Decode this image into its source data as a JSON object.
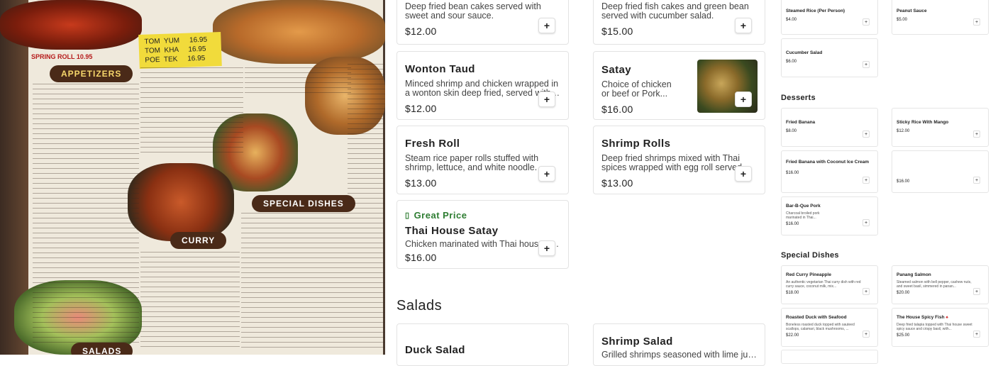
{
  "menu_photo": {
    "appetizers_header": "APPETIZERS",
    "special_header": "SPECIAL DISHES",
    "curry_header": "CURRY",
    "salads_header": "SALADS",
    "spring_note": "SPRING  ROLL  10.95",
    "sticky_note": [
      "TOM  YUM     16.95",
      "TOM  KHA     16.95",
      "POE  TEK     16.95"
    ]
  },
  "cards": {
    "c1": {
      "desc": "Deep fried bean cakes served with sweet and sour sauce.",
      "price": "$12.00"
    },
    "c2": {
      "desc": "Deep fried fish cakes and green bean served with cucumber salad.",
      "price": "$15.00"
    },
    "wonton": {
      "name": "Wonton Taud",
      "desc": "Minced shrimp and chicken wrapped in a wonton skin deep fried, served with sweet ...",
      "price": "$12.00"
    },
    "satay": {
      "name": "Satay",
      "desc": "Choice of chicken or beef or Pork...",
      "price": "$16.00"
    },
    "fresh_roll": {
      "name": "Fresh Roll",
      "desc": "Steam rice paper rolls stuffed with shrimp, lettuce, and white noodle.",
      "price": "$13.00"
    },
    "shrimp_rolls": {
      "name": "Shrimp Rolls",
      "desc": "Deep fried shrimps mixed with Thai spices wrapped with egg roll served with sweet...",
      "price": "$13.00"
    },
    "house_satay": {
      "badge": "Great Price",
      "name": "Thai House Satay",
      "desc": "Chicken marinated with Thai house special spices...",
      "price": "$16.00"
    }
  },
  "salads": {
    "title": "Salads",
    "duck": {
      "name": "Duck Salad"
    },
    "shrimp": {
      "name": "Shrimp Salad",
      "desc": "Grilled shrimps seasoned with lime juices"
    }
  },
  "right": {
    "sides": [
      {
        "name": "Steamed Rice (Per Person)",
        "price": "$4.00"
      },
      {
        "name": "Peanut Sauce",
        "price": "$5.00"
      },
      {
        "name": "Cucumber Salad",
        "price": "$6.00"
      }
    ],
    "desserts_title": "Desserts",
    "desserts": [
      {
        "name": "Fried Banana",
        "price": "$8.00"
      },
      {
        "name": "Sticky Rice With Mango",
        "price": "$12.00"
      },
      {
        "name": "Fried Banana with Coconut Ice Cream",
        "price": "$16.00"
      },
      {
        "name": "",
        "price": "$16.00"
      },
      {
        "name": "Bar-B-Que Pork",
        "desc": "Charcoal broiled pork marinated in Thai...",
        "price": "$16.00"
      }
    ],
    "special_title": "Special Dishes",
    "special": [
      {
        "name": "Red Curry Pineapple",
        "desc": "An authentic vegetarian Thai curry dish with red curry sauce, coconut milk, mix...",
        "price": "$18.00"
      },
      {
        "name": "Panang Salmon",
        "desc": "Steamed salmon with bell pepper, cashew nuts, and sweet basil, simmered in panan...",
        "price": "$20.00"
      },
      {
        "name": "Roasted Duck with Seafood",
        "desc": "Boneless roasted duck topped with sauteed scallops, calamari, black mushrooms, ...",
        "price": "$22.00"
      },
      {
        "name": "The House Spicy Fish",
        "desc": "Deep fried talapia topped with Thai house sweet spicy sauce and crispy basil, with...",
        "price": "$25.00"
      }
    ],
    "plus_glyph": "+"
  },
  "colors": {
    "accent_green": "#2e7d32",
    "menu_header": "#4a2a18"
  }
}
